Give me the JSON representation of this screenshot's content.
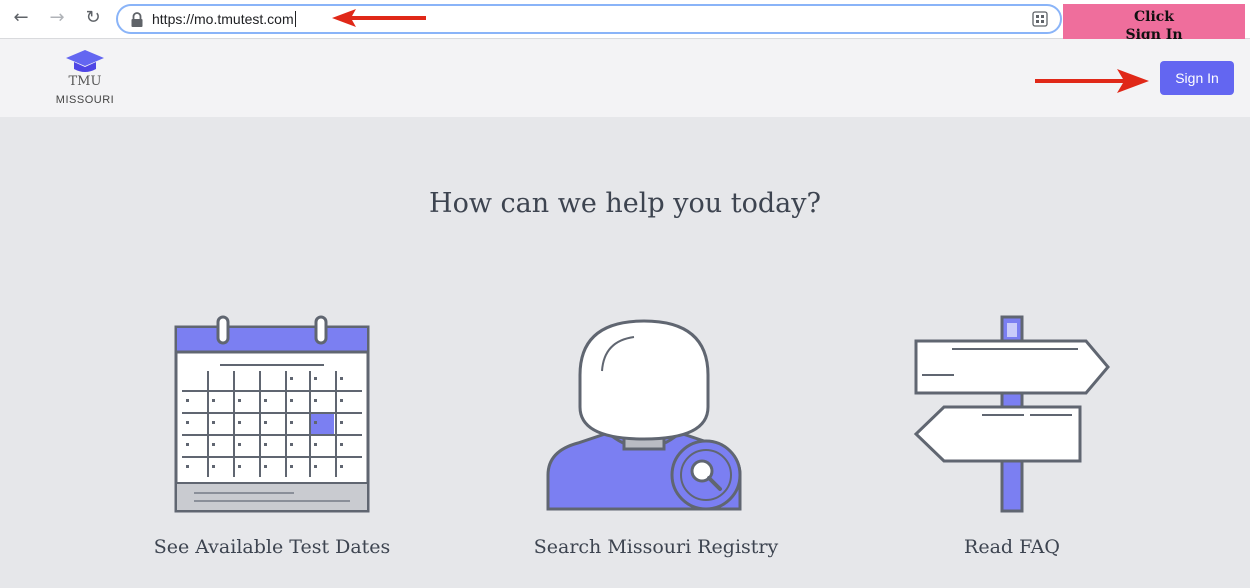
{
  "browser": {
    "url": "https://mo.tmutest.com",
    "icons": [
      "back-arrow-icon",
      "forward-arrow-icon",
      "reload-icon",
      "lock-icon",
      "qr-code-icon"
    ]
  },
  "callout": {
    "line1": "Click",
    "line2": "Sign In",
    "color": "#ef6e9c"
  },
  "header": {
    "logo_text": "TMU",
    "logo_subtext": "MISSOURI",
    "sign_in_label": "Sign In"
  },
  "main": {
    "headline": "How can we help you today?",
    "options": [
      {
        "label": "See Available Test Dates",
        "icon": "calendar-icon"
      },
      {
        "label": "Search Missouri Registry",
        "icon": "person-search-icon"
      },
      {
        "label": "Read FAQ",
        "icon": "signpost-icon"
      }
    ]
  },
  "colors": {
    "accent": "#6366f1",
    "illustration_purple": "#7b7ff2",
    "annotation_arrow": "#e02818"
  }
}
